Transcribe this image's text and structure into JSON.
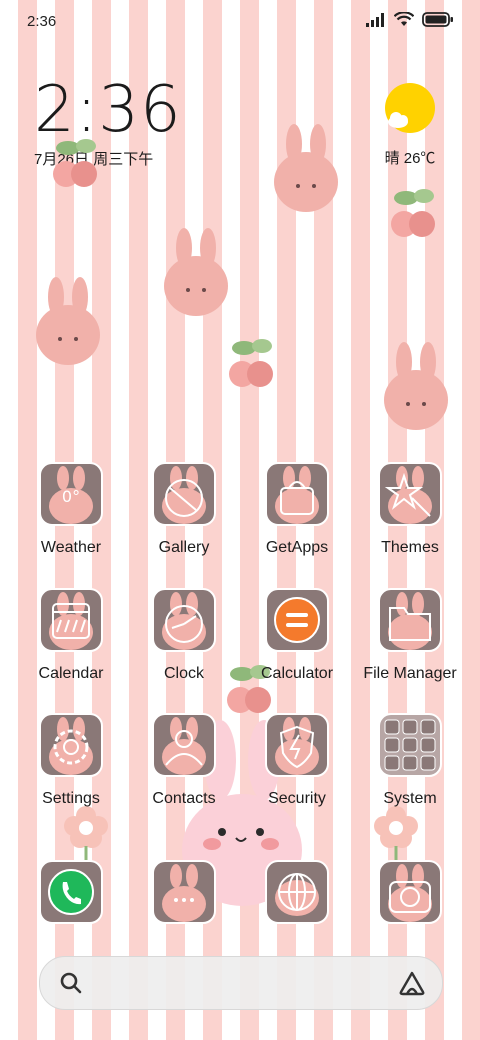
{
  "status_bar": {
    "time": "2:36",
    "icons": [
      "signal-icon",
      "wifi-icon",
      "battery-icon"
    ]
  },
  "clock_widget": {
    "time": "2:36",
    "date": "7月26日 周三下午"
  },
  "weather_widget": {
    "condition_temp": "晴 26℃",
    "icon": "sunny-cloud-icon"
  },
  "apps": [
    {
      "label": "Weather",
      "icon": "weather-icon"
    },
    {
      "label": "Gallery",
      "icon": "gallery-icon"
    },
    {
      "label": "GetApps",
      "icon": "getapps-icon"
    },
    {
      "label": "Themes",
      "icon": "themes-icon"
    },
    {
      "label": "Calendar",
      "icon": "calendar-icon"
    },
    {
      "label": "Clock",
      "icon": "clock-icon"
    },
    {
      "label": "Calculator",
      "icon": "calculator-icon"
    },
    {
      "label": "File Manager",
      "icon": "file-manager-icon"
    },
    {
      "label": "Settings",
      "icon": "settings-icon"
    },
    {
      "label": "Contacts",
      "icon": "contacts-icon"
    },
    {
      "label": "Security",
      "icon": "security-icon"
    },
    {
      "label": "System",
      "icon": "system-folder-icon"
    }
  ],
  "dock": [
    {
      "icon": "phone-icon"
    },
    {
      "icon": "messages-icon"
    },
    {
      "icon": "browser-icon"
    },
    {
      "icon": "camera-icon"
    }
  ],
  "search_bar": {
    "left_icon": "search-icon",
    "right_icon": "assistant-icon"
  },
  "colors": {
    "stripe": "#fbd3cf",
    "icon_bg": "#8a7877",
    "bunny": "#f1b1aa",
    "sun": "#ffd200"
  }
}
